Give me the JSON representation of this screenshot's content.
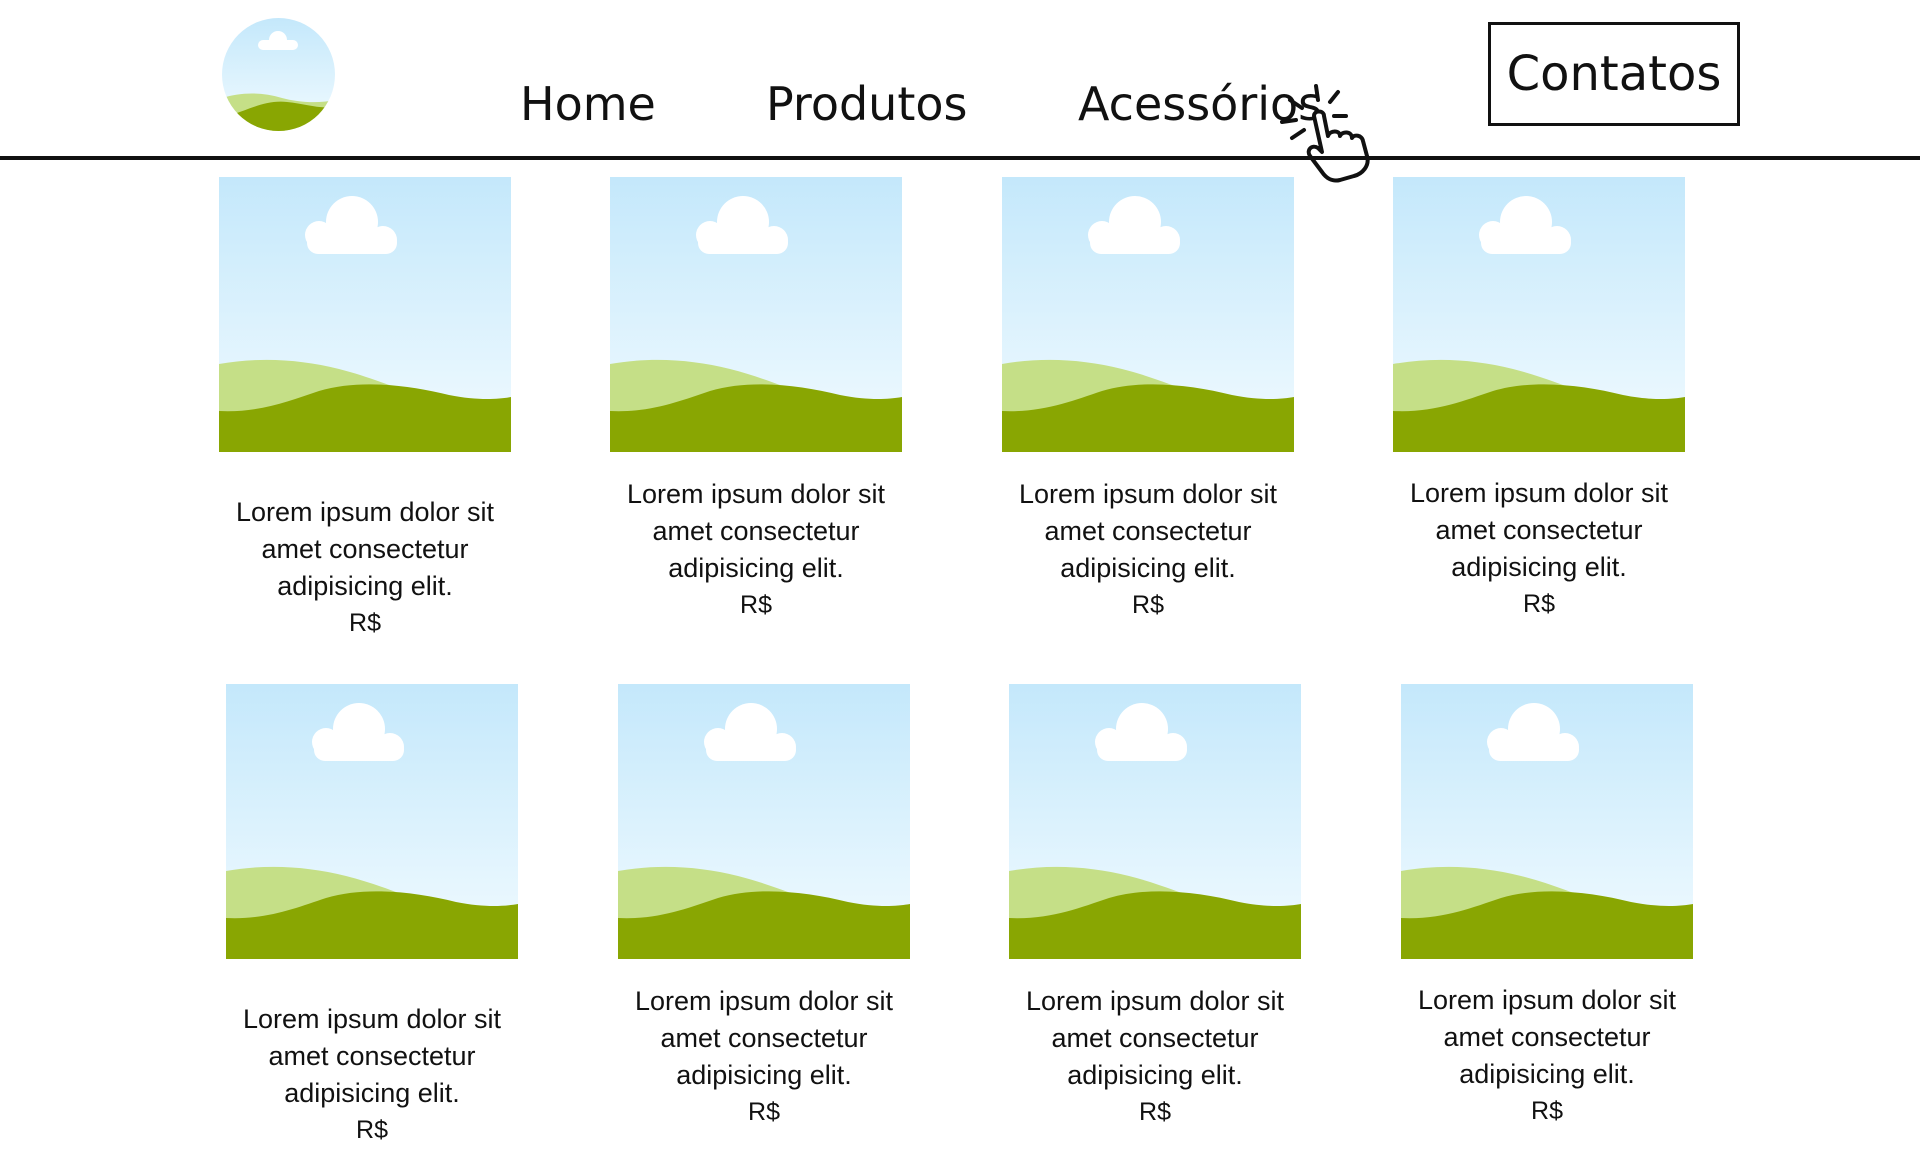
{
  "nav": {
    "home": "Home",
    "produtos": "Produtos",
    "acessorios": "Acessórios",
    "contatos": "Contatos"
  },
  "icons": {
    "logo": "landscape-logo-icon",
    "cursor": "pointer-hand-click-icon",
    "thumbnail": "image-placeholder-icon"
  },
  "colors": {
    "sky_top": "#c4e8fb",
    "sky_bottom": "#f2fbff",
    "hill_light": "#c5df87",
    "hill_dark": "#89a602"
  },
  "products": [
    {
      "desc": "Lorem ipsum dolor sit amet consectetur adipisicing elit.",
      "price": "R$"
    },
    {
      "desc": "Lorem ipsum dolor sit amet consectetur adipisicing elit.",
      "price": "R$"
    },
    {
      "desc": "Lorem ipsum dolor sit amet consectetur adipisicing elit.",
      "price": "R$"
    },
    {
      "desc": "Lorem ipsum dolor sit amet consectetur adipisicing elit.",
      "price": "R$"
    },
    {
      "desc": "Lorem ipsum dolor sit amet consectetur adipisicing elit.",
      "price": "R$"
    },
    {
      "desc": "Lorem ipsum dolor sit amet consectetur adipisicing elit.",
      "price": "R$"
    },
    {
      "desc": "Lorem ipsum dolor sit amet consectetur adipisicing elit.",
      "price": "R$"
    },
    {
      "desc": "Lorem ipsum dolor sit amet consectetur adipisicing elit.",
      "price": "R$"
    }
  ]
}
